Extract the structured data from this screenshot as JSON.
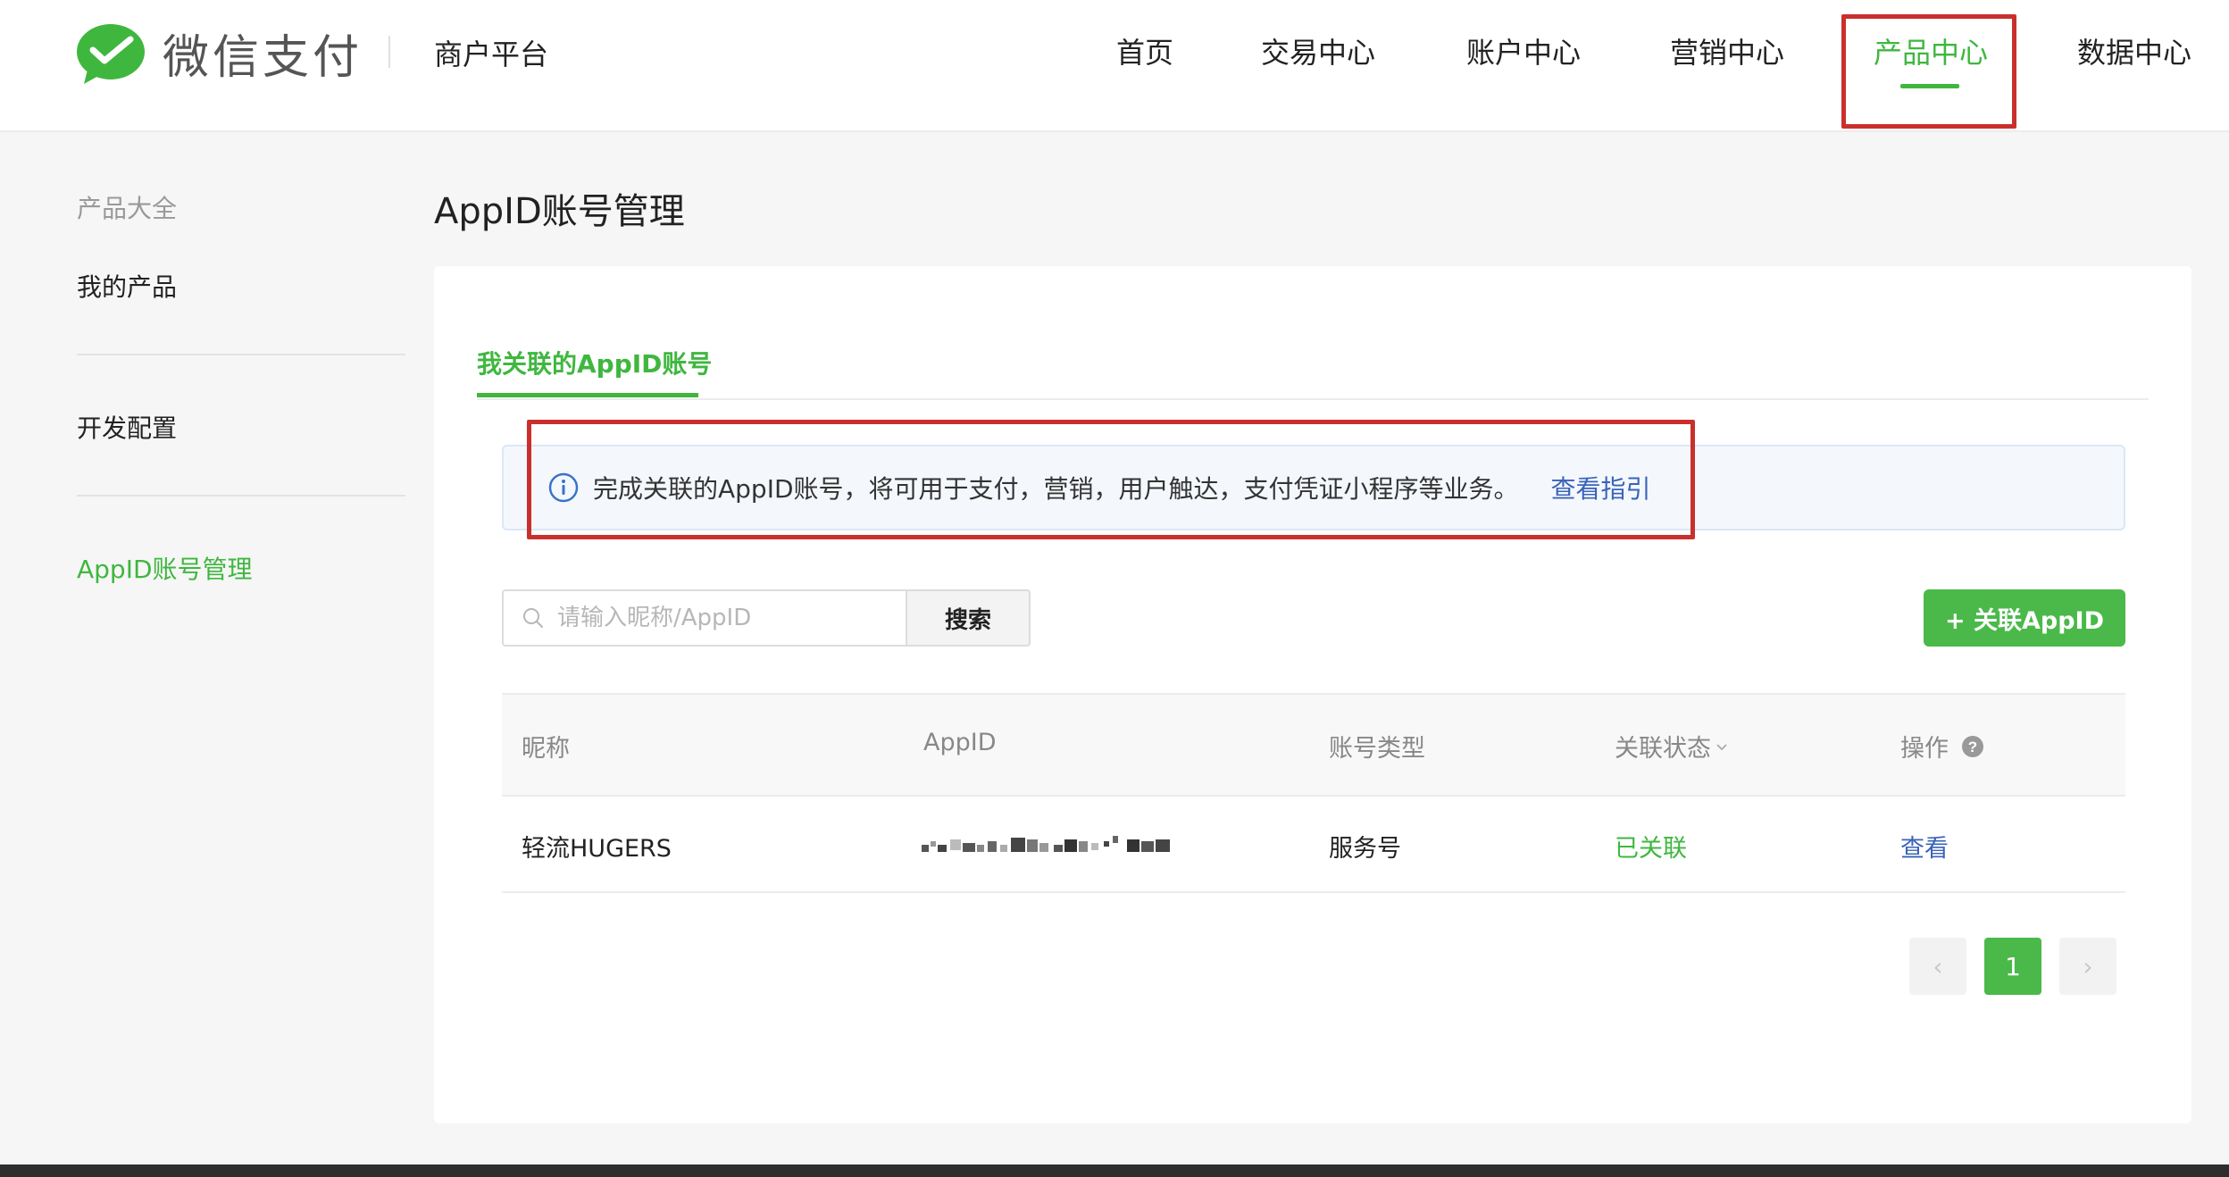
{
  "header": {
    "brand": "微信支付",
    "platform": "商户平台",
    "nav": [
      {
        "label": "首页"
      },
      {
        "label": "交易中心"
      },
      {
        "label": "账户中心"
      },
      {
        "label": "营销中心"
      },
      {
        "label": "产品中心",
        "active": true
      },
      {
        "label": "数据中心"
      }
    ]
  },
  "sidebar": {
    "heading": "产品大全",
    "items": [
      {
        "label": "我的产品"
      },
      {
        "label": "开发配置"
      },
      {
        "label": "AppID账号管理",
        "active": true
      }
    ]
  },
  "main": {
    "title": "AppID账号管理",
    "tab": "我关联的AppID账号",
    "notice": {
      "text": "完成关联的AppID账号，将可用于支付，营销，用户触达，支付凭证小程序等业务。",
      "link": "查看指引"
    },
    "search": {
      "placeholder": "请输入昵称/AppID",
      "value": "",
      "button": "搜索"
    },
    "add_button": "+ 关联AppID",
    "table": {
      "columns": [
        "昵称",
        "AppID",
        "账号类型",
        "关联状态",
        "操作"
      ],
      "rows": [
        {
          "nickname": "轻流HUGERS",
          "appid": "",
          "type": "服务号",
          "status": "已关联",
          "action": "查看"
        }
      ]
    },
    "pagination": {
      "current": "1",
      "prev": "‹",
      "next": "›"
    }
  },
  "colors": {
    "accent": "#3fb73f",
    "link": "#3a63b8",
    "annotation": "#c9302c"
  }
}
